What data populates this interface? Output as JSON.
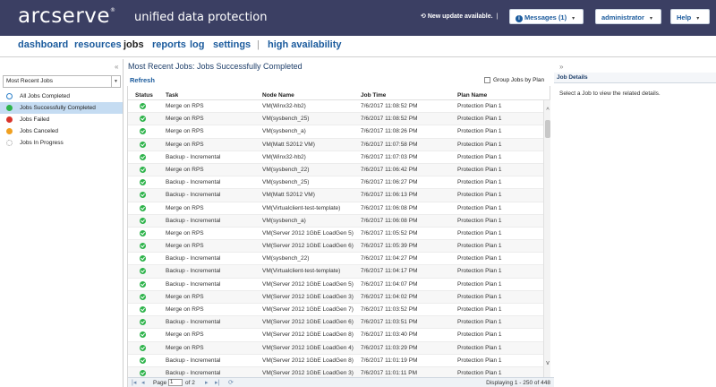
{
  "header": {
    "logo_text": "arcserve",
    "logo_tm": "®",
    "product": "unified data protection",
    "update_text": "New update available.",
    "messages_label": "Messages (1)",
    "user_label": "administrator",
    "help_label": "Help",
    "bg_color": "#3b3f63"
  },
  "nav": {
    "items": [
      "dashboard",
      "resources",
      "jobs",
      "reports",
      "log",
      "settings",
      "high availability"
    ],
    "active": "jobs",
    "separator": "|"
  },
  "left": {
    "dropdown_value": "Most Recent Jobs",
    "filters": [
      {
        "label": "All Jobs Completed",
        "icon": "info-icon",
        "color": "#2a7fc9"
      },
      {
        "label": "Jobs Successfully Completed",
        "icon": "success-icon",
        "color": "#2db34a"
      },
      {
        "label": "Jobs Failed",
        "icon": "error-icon",
        "color": "#d9342b"
      },
      {
        "label": "Jobs Canceled",
        "icon": "warning-icon",
        "color": "#f0a020"
      },
      {
        "label": "Jobs In Progress",
        "icon": "spinner-icon",
        "color": "#999999"
      }
    ],
    "selected_index": 1
  },
  "center": {
    "title": "Most Recent Jobs: Jobs Successfully Completed",
    "refresh": "Refresh",
    "group_label": "Group Jobs by Plan",
    "columns": [
      "Status",
      "Task",
      "Node Name",
      "Job Time",
      "Plan Name"
    ],
    "rows": [
      [
        "Merge on RPS",
        "VM(Winx32-hb2)",
        "7/6/2017 11:08:52 PM",
        "Protection Plan 1"
      ],
      [
        "Merge on RPS",
        "VM(sysbench_25)",
        "7/6/2017 11:08:52 PM",
        "Protection Plan 1"
      ],
      [
        "Merge on RPS",
        "VM(sysbench_a)",
        "7/6/2017 11:08:26 PM",
        "Protection Plan 1"
      ],
      [
        "Merge on RPS",
        "VM(Matt S2012 VM)",
        "7/6/2017 11:07:58 PM",
        "Protection Plan 1"
      ],
      [
        "Backup - Incremental",
        "VM(Winx32-hb2)",
        "7/6/2017 11:07:03 PM",
        "Protection Plan 1"
      ],
      [
        "Merge on RPS",
        "VM(sysbench_22)",
        "7/6/2017 11:06:42 PM",
        "Protection Plan 1"
      ],
      [
        "Backup - Incremental",
        "VM(sysbench_25)",
        "7/6/2017 11:06:27 PM",
        "Protection Plan 1"
      ],
      [
        "Backup - Incremental",
        "VM(Matt S2012 VM)",
        "7/6/2017 11:06:13 PM",
        "Protection Plan 1"
      ],
      [
        "Merge on RPS",
        "VM(Virtualclient-test-template)",
        "7/6/2017 11:06:08 PM",
        "Protection Plan 1"
      ],
      [
        "Backup - Incremental",
        "VM(sysbench_a)",
        "7/6/2017 11:06:08 PM",
        "Protection Plan 1"
      ],
      [
        "Merge on RPS",
        "VM(Server 2012 1GbE LoadGen 5)",
        "7/6/2017 11:05:52 PM",
        "Protection Plan 1"
      ],
      [
        "Merge on RPS",
        "VM(Server 2012 1GbE LoadGen 6)",
        "7/6/2017 11:05:39 PM",
        "Protection Plan 1"
      ],
      [
        "Backup - Incremental",
        "VM(sysbench_22)",
        "7/6/2017 11:04:27 PM",
        "Protection Plan 1"
      ],
      [
        "Backup - Incremental",
        "VM(Virtualclient-test-template)",
        "7/6/2017 11:04:17 PM",
        "Protection Plan 1"
      ],
      [
        "Backup - Incremental",
        "VM(Server 2012 1GbE LoadGen 5)",
        "7/6/2017 11:04:07 PM",
        "Protection Plan 1"
      ],
      [
        "Merge on RPS",
        "VM(Server 2012 1GbE LoadGen 3)",
        "7/6/2017 11:04:02 PM",
        "Protection Plan 1"
      ],
      [
        "Merge on RPS",
        "VM(Server 2012 1GbE LoadGen 7)",
        "7/6/2017 11:03:52 PM",
        "Protection Plan 1"
      ],
      [
        "Backup - Incremental",
        "VM(Server 2012 1GbE LoadGen 6)",
        "7/6/2017 11:03:51 PM",
        "Protection Plan 1"
      ],
      [
        "Merge on RPS",
        "VM(Server 2012 1GbE LoadGen 8)",
        "7/6/2017 11:03:40 PM",
        "Protection Plan 1"
      ],
      [
        "Merge on RPS",
        "VM(Server 2012 1GbE LoadGen 4)",
        "7/6/2017 11:03:29 PM",
        "Protection Plan 1"
      ],
      [
        "Backup - Incremental",
        "VM(Server 2012 1GbE LoadGen 8)",
        "7/6/2017 11:01:19 PM",
        "Protection Plan 1"
      ],
      [
        "Backup - Incremental",
        "VM(Server 2012 1GbE LoadGen 3)",
        "7/6/2017 11:01:11 PM",
        "Protection Plan 1"
      ]
    ]
  },
  "pager": {
    "page_label": "Page",
    "page_value": "1",
    "of_label": "of 2",
    "display": "Displaying 1 - 250 of 448"
  },
  "right": {
    "title": "Job Details",
    "message": "Select a Job to view the related details."
  }
}
